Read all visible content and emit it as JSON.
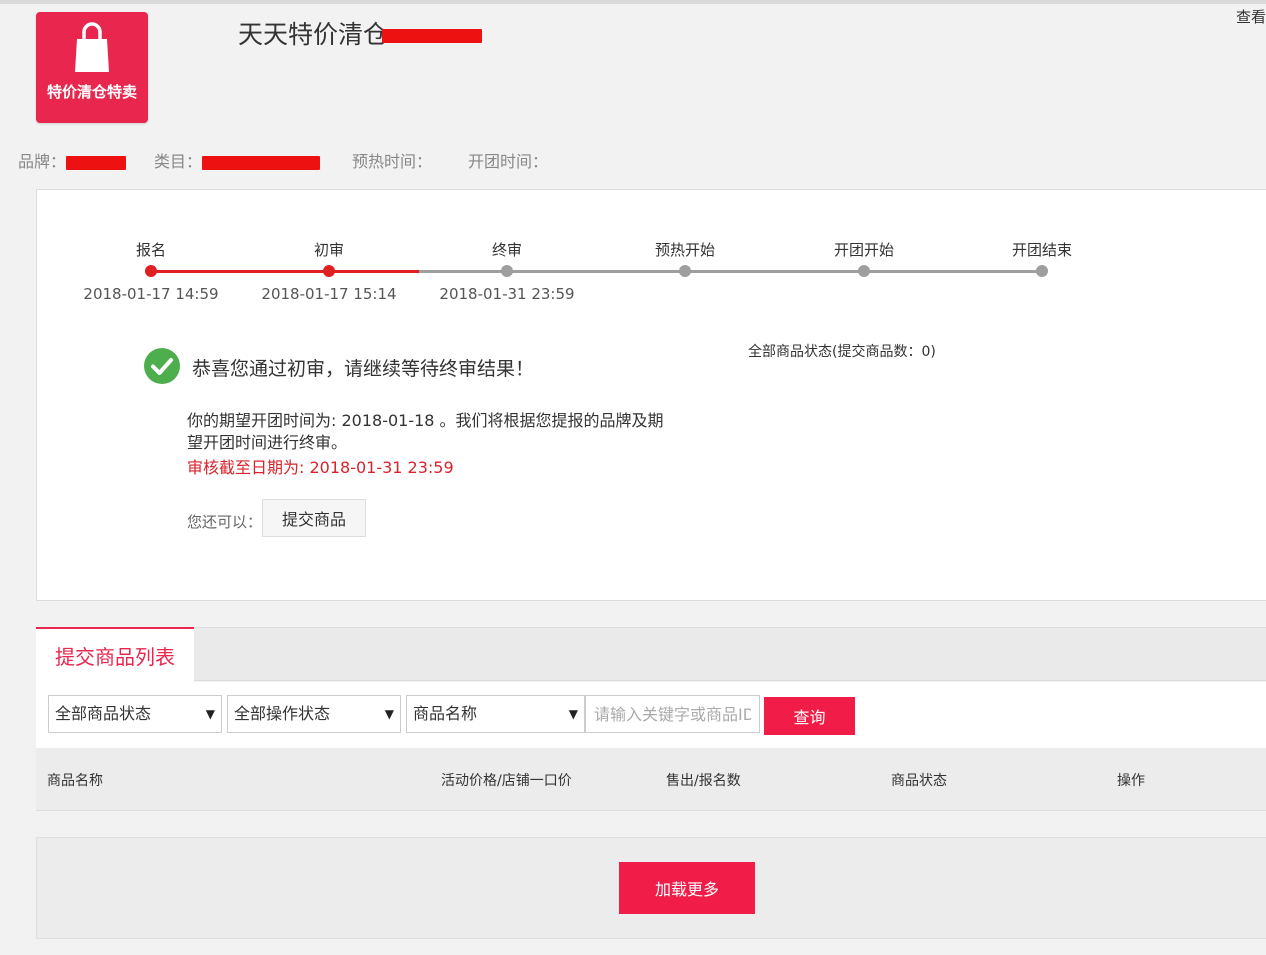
{
  "header": {
    "logo_text": "特价清仓特卖",
    "title_visible": "天天特价清仓",
    "view_link": "查看"
  },
  "meta": {
    "brand_label": "品牌：",
    "category_label": "类目：",
    "preheat_label": "预热时间：",
    "open_label": "开团时间："
  },
  "progress": {
    "steps": [
      {
        "label": "报名",
        "date": "2018-01-17 14:59"
      },
      {
        "label": "初审",
        "date": "2018-01-17 15:14"
      },
      {
        "label": "终审",
        "date": "2018-01-31 23:59"
      },
      {
        "label": "预热开始",
        "date": ""
      },
      {
        "label": "开团开始",
        "date": ""
      },
      {
        "label": "开团结束",
        "date": ""
      }
    ],
    "active_color": "#e02020",
    "inactive_color": "#9e9e9e"
  },
  "status": {
    "congrats": "恭喜您通过初审，请继续等待终审结果！",
    "summary": "全部商品状态(提交商品数：0)",
    "description": "你的期望开团时间为: 2018-01-18 。我们将根据您提报的品牌及期望开团时间进行终审。",
    "deadline": "审核截至日期为: 2018-01-31 23:59",
    "can_also": "您还可以：",
    "submit_button": "提交商品",
    "check_color": "#4cae4c"
  },
  "tabs": {
    "active": "提交商品列表"
  },
  "filters": {
    "product_status": "全部商品状态",
    "operation_status": "全部操作状态",
    "search_field": "商品名称",
    "search_placeholder": "请输入关键字或商品ID",
    "query_button": "查询"
  },
  "table": {
    "columns": [
      "商品名称",
      "活动价格/店铺一口价",
      "售出/报名数",
      "商品状态",
      "操作"
    ]
  },
  "load_more": "加载更多",
  "colors": {
    "accent": "#f11d48",
    "brand": "#e8264e",
    "redaction": "#ee1111"
  }
}
